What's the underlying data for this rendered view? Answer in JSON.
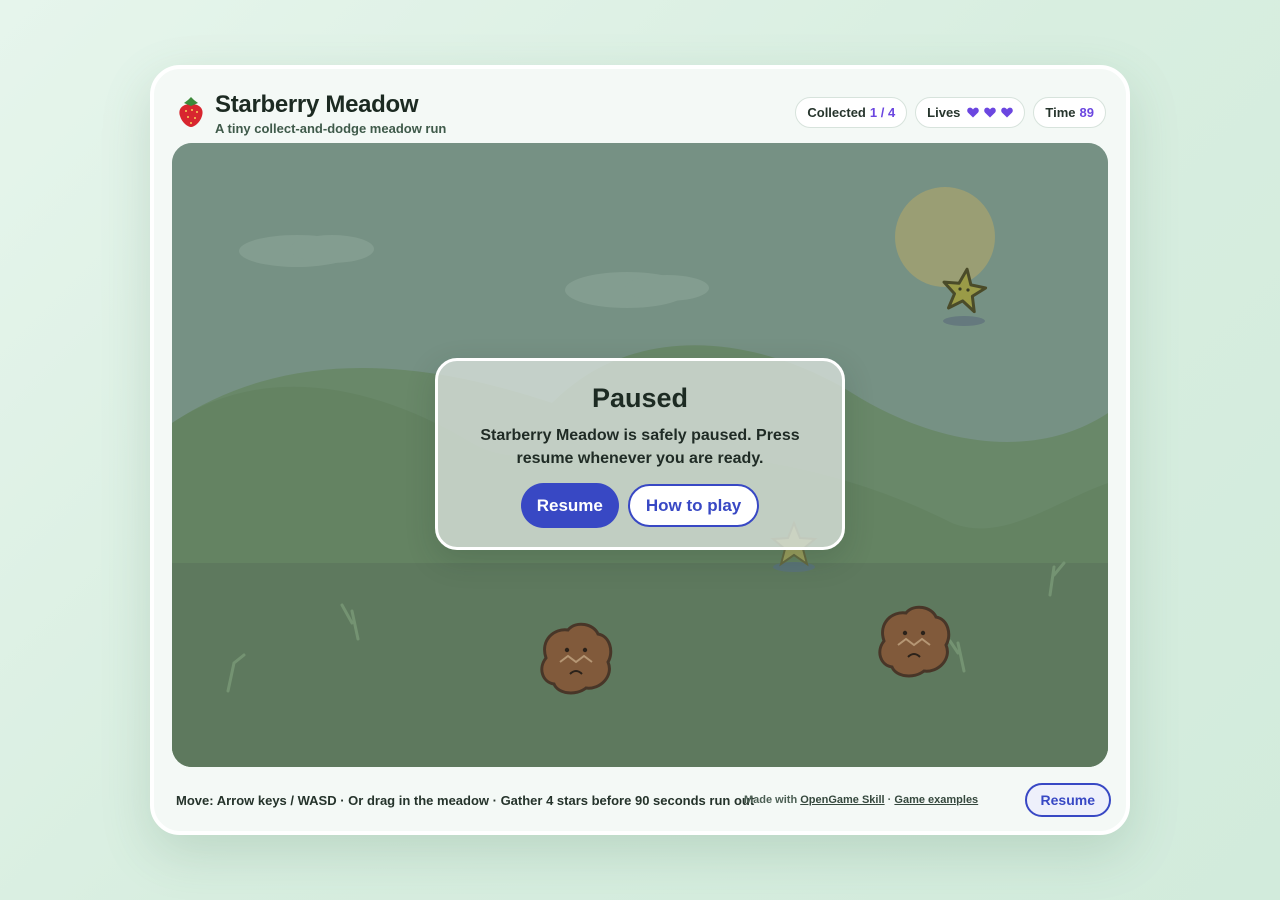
{
  "header": {
    "title": "Starberry Meadow",
    "subtitle": "A tiny collect-and-dodge meadow run"
  },
  "hud": {
    "collected_label": "Collected",
    "collected_value": "1 / 4",
    "lives_label": "Lives",
    "lives_count": 3,
    "time_label": "Time",
    "time_value": "89"
  },
  "pause_dialog": {
    "title": "Paused",
    "message": "Starberry Meadow is safely paused. Press resume whenever you are ready.",
    "resume_label": "Resume",
    "howto_label": "How to play"
  },
  "footer": {
    "controls_hint": "Move: Arrow keys / WASD · Or drag in the meadow · Gather 4 stars before 90 seconds run out",
    "made_with_prefix": "Made with",
    "skill_link": "OpenGame Skill",
    "separator": "·",
    "examples_link": "Game examples",
    "resume_label": "Resume"
  },
  "colors": {
    "accent": "#3848c4",
    "counter": "#6b46e0",
    "sky": "#7f9a8c",
    "grass": "#6a8a66"
  },
  "icons": {
    "logo": "strawberry-icon",
    "life": "heart-icon"
  }
}
